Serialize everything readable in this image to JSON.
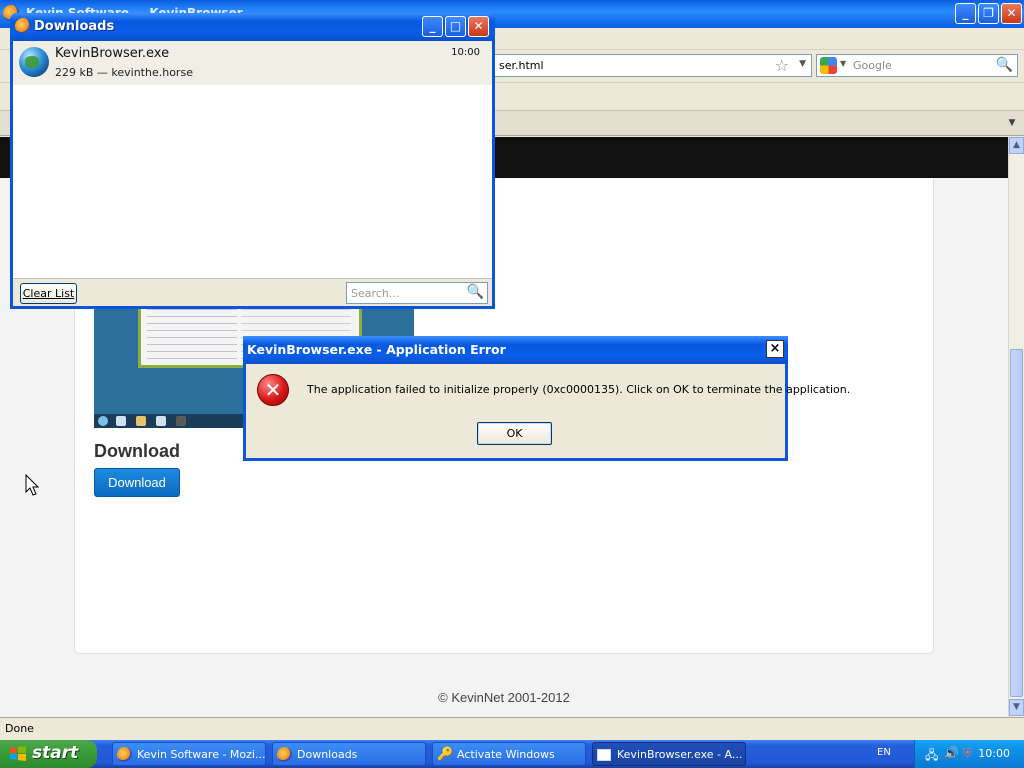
{
  "browser": {
    "window_title": "Kevin Software — KevinBrowser",
    "url": "ser.html",
    "search_placeholder": "Google",
    "status_text": "Done"
  },
  "page": {
    "download_heading": "Download",
    "download_button": "Download",
    "copyright": "© KevinNet 2001-2012"
  },
  "downloads_window": {
    "title": "Downloads",
    "item": {
      "filename": "KevinBrowser.exe",
      "size_source": "229 kB — kevinthe.horse",
      "time": "10:00"
    },
    "clear_list": "Clear List",
    "search_placeholder": "Search..."
  },
  "error_dialog": {
    "title": "KevinBrowser.exe - Application Error",
    "message": "The application failed to initialize properly (0xc0000135). Click on OK to terminate the application.",
    "ok": "OK",
    "close": "×"
  },
  "taskbar": {
    "start": "start",
    "buttons": [
      {
        "label": "Kevin Software - Mozi...",
        "icon": "firefox-icon"
      },
      {
        "label": "Downloads",
        "icon": "firefox-icon"
      },
      {
        "label": "Activate Windows",
        "icon": "keys-icon"
      },
      {
        "label": "KevinBrowser.exe - A...",
        "icon": "window-icon"
      }
    ],
    "language": "EN",
    "clock": "10:00"
  },
  "colors": {
    "xp_blue": "#0a55d8",
    "start_green": "#3d9e3d",
    "download_button": "#0c6cc0",
    "error_red": "#d41818"
  }
}
